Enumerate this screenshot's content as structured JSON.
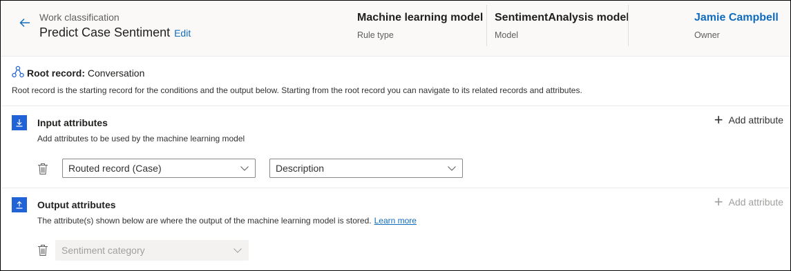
{
  "header": {
    "eyebrow": "Work classification",
    "title": "Predict Case Sentiment",
    "edit_label": "Edit",
    "fields": [
      {
        "value": "Machine learning model",
        "label": "Rule type"
      },
      {
        "value": "SentimentAnalysis model",
        "label": "Model"
      },
      {
        "value": "Jamie Campbell",
        "label": "Owner"
      }
    ]
  },
  "root_record": {
    "label": "Root record:",
    "value": "Conversation",
    "description": "Root record is the starting record for the conditions and the output below. Starting from the root record you can navigate to its related records and attributes."
  },
  "input_attributes": {
    "title": "Input attributes",
    "description": "Add attributes to be used by the machine learning model",
    "add_label": "Add attribute",
    "rows": [
      {
        "record": "Routed record (Case)",
        "attribute": "Description"
      }
    ]
  },
  "output_attributes": {
    "title": "Output attributes",
    "description": "The attribute(s) shown below are where the output of the machine learning model is stored.",
    "learn_more": "Learn more",
    "add_label": "Add attribute",
    "rows": [
      {
        "attribute": "Sentiment category"
      }
    ]
  },
  "colors": {
    "accent": "#0f6cbd",
    "icon_bg": "#1f63d6"
  },
  "icons": [
    "back-arrow-icon",
    "root-record-icon",
    "download-icon",
    "upload-icon",
    "plus-icon",
    "trash-icon",
    "chevron-down-icon"
  ]
}
